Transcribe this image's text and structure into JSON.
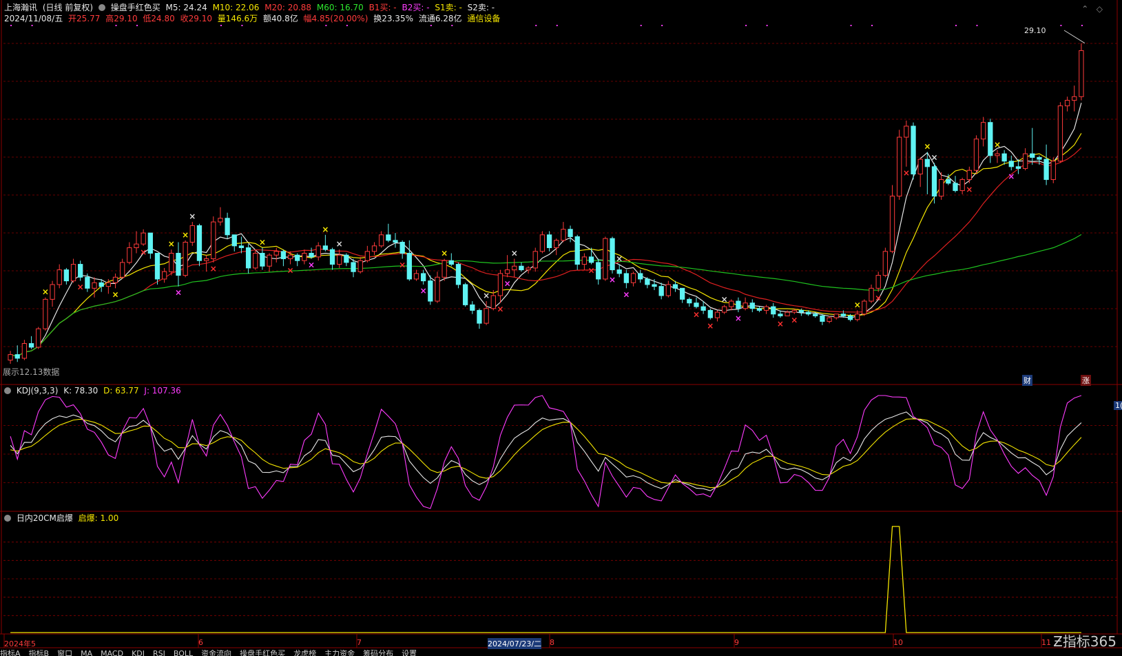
{
  "header": {
    "stock_name": "上海瀚讯",
    "period": "(日线 前复权)",
    "indicator": "操盘手红色买",
    "m5": "M5: 24.24",
    "m10": "M10: 22.06",
    "m20": "M20: 20.88",
    "m60": "M60: 16.70",
    "b1": "B1买: -",
    "b2": "B2买: -",
    "s1": "S1卖: -",
    "s2": "S2卖: -"
  },
  "info": {
    "date": "2024/11/08/五",
    "open": "开25.77",
    "high": "高29.10",
    "low": "低24.80",
    "close": "收29.10",
    "volume": "量146.6万",
    "amount": "额40.8亿",
    "change": "幅4.85(20.00%)",
    "turnover": "换23.35%",
    "float": "流通6.28亿",
    "sector": "通信设备"
  },
  "price_label": "29.10",
  "overlay_text": "展示12.13数据",
  "tags": {
    "cai": "财",
    "zhang": "涨"
  },
  "kdj": {
    "title": "KDJ(9,3,3)",
    "k": "K: 78.30",
    "d": "D: 63.77",
    "j": "J: 107.36"
  },
  "burst": {
    "title": "日内20CM启爆",
    "value": "启爆: 1.00"
  },
  "x_axis": [
    "2024年5",
    "6",
    "7",
    "2024/07/23/二",
    "8",
    "9",
    "10",
    "11"
  ],
  "right_tag": "1(",
  "watermark": "指标365",
  "bottom_tabs": [
    "指标A",
    "指标B",
    "窗口",
    "MA",
    "MACD",
    "KDJ",
    "RSI",
    "BOLL",
    "资金流向",
    "操盘手红色买",
    "龙虎榜",
    "主力资金",
    "筹码分布",
    "设置"
  ],
  "colors": {
    "up": "#ff3b3b",
    "down": "#5ff3f3",
    "ma5": "#e8e8e8",
    "ma10": "#f5e600",
    "ma20": "#e02020",
    "ma60": "#1fc41f",
    "grid": "#8b0000",
    "j": "#ff3cff"
  },
  "chart_data": {
    "type": "candlestick",
    "candles": [
      [
        12.1,
        12.6,
        11.9,
        12.4
      ],
      [
        12.4,
        12.9,
        12.0,
        12.2
      ],
      [
        12.2,
        13.2,
        12.1,
        13.0
      ],
      [
        13.0,
        13.4,
        12.7,
        12.8
      ],
      [
        12.8,
        13.9,
        12.7,
        13.8
      ],
      [
        13.8,
        15.5,
        13.7,
        15.4
      ],
      [
        15.4,
        16.4,
        15.0,
        16.2
      ],
      [
        16.2,
        17.3,
        16.0,
        17.0
      ],
      [
        17.0,
        17.1,
        16.2,
        16.4
      ],
      [
        16.4,
        17.6,
        16.3,
        17.3
      ],
      [
        17.3,
        17.5,
        16.4,
        16.6
      ],
      [
        16.6,
        16.8,
        15.8,
        16.0
      ],
      [
        16.0,
        16.6,
        15.5,
        16.3
      ],
      [
        16.3,
        16.5,
        15.8,
        16.1
      ],
      [
        16.1,
        16.5,
        15.7,
        16.3
      ],
      [
        16.3,
        16.8,
        16.0,
        16.6
      ],
      [
        16.6,
        17.6,
        16.5,
        17.4
      ],
      [
        17.4,
        18.5,
        17.3,
        18.2
      ],
      [
        18.2,
        19.1,
        17.9,
        18.4
      ],
      [
        18.4,
        19.2,
        18.3,
        19.0
      ],
      [
        19.0,
        19.0,
        17.6,
        17.9
      ],
      [
        17.9,
        17.9,
        16.2,
        16.5
      ],
      [
        16.5,
        17.1,
        16.3,
        16.9
      ],
      [
        16.9,
        18.1,
        16.7,
        17.9
      ],
      [
        17.9,
        18.5,
        16.1,
        16.7
      ],
      [
        16.7,
        18.6,
        16.6,
        18.5
      ],
      [
        18.5,
        19.6,
        18.3,
        19.4
      ],
      [
        19.4,
        19.5,
        17.2,
        17.5
      ],
      [
        17.5,
        17.8,
        16.9,
        17.6
      ],
      [
        17.6,
        19.9,
        17.4,
        19.6
      ],
      [
        19.6,
        20.4,
        19.4,
        19.8
      ],
      [
        19.8,
        20.1,
        18.7,
        18.9
      ],
      [
        18.9,
        18.9,
        18.0,
        18.3
      ],
      [
        18.3,
        18.8,
        17.9,
        18.2
      ],
      [
        18.2,
        18.4,
        16.8,
        17.1
      ],
      [
        17.1,
        18.1,
        17.0,
        17.9
      ],
      [
        17.9,
        18.2,
        17.0,
        17.2
      ],
      [
        17.2,
        17.9,
        16.9,
        17.8
      ],
      [
        17.8,
        18.2,
        17.4,
        18.0
      ],
      [
        18.0,
        18.1,
        17.2,
        17.6
      ],
      [
        17.6,
        18.0,
        17.3,
        17.8
      ],
      [
        17.8,
        17.9,
        17.2,
        17.5
      ],
      [
        17.5,
        18.1,
        17.3,
        17.9
      ],
      [
        17.9,
        18.2,
        17.6,
        17.7
      ],
      [
        17.7,
        18.5,
        17.5,
        18.3
      ],
      [
        18.3,
        18.9,
        18.0,
        18.1
      ],
      [
        18.1,
        18.2,
        17.0,
        17.3
      ],
      [
        17.3,
        18.1,
        17.1,
        17.8
      ],
      [
        17.8,
        17.9,
        17.2,
        17.4
      ],
      [
        17.4,
        17.6,
        16.6,
        16.9
      ],
      [
        16.9,
        17.7,
        16.8,
        17.5
      ],
      [
        17.5,
        18.3,
        17.4,
        18.0
      ],
      [
        18.0,
        18.5,
        17.8,
        18.3
      ],
      [
        18.3,
        19.1,
        18.2,
        18.9
      ],
      [
        18.9,
        19.5,
        18.5,
        18.6
      ],
      [
        18.6,
        19.0,
        18.2,
        18.5
      ],
      [
        18.5,
        18.6,
        17.6,
        17.9
      ],
      [
        17.9,
        18.6,
        16.4,
        16.5
      ],
      [
        16.5,
        17.0,
        16.4,
        16.8
      ],
      [
        16.8,
        17.0,
        16.2,
        16.4
      ],
      [
        16.4,
        16.7,
        15.1,
        15.3
      ],
      [
        15.3,
        16.9,
        15.2,
        16.6
      ],
      [
        16.6,
        17.6,
        16.4,
        17.5
      ],
      [
        17.5,
        17.9,
        17.2,
        17.3
      ],
      [
        17.3,
        17.4,
        16.0,
        16.2
      ],
      [
        16.2,
        16.3,
        15.0,
        15.1
      ],
      [
        15.1,
        15.3,
        14.6,
        14.8
      ],
      [
        14.8,
        14.9,
        13.8,
        14.1
      ],
      [
        14.1,
        15.3,
        14.0,
        14.9
      ],
      [
        14.9,
        15.9,
        14.8,
        15.6
      ],
      [
        15.6,
        17.0,
        15.2,
        16.8
      ],
      [
        16.8,
        17.8,
        16.6,
        17.0
      ],
      [
        17.0,
        17.6,
        16.6,
        17.2
      ],
      [
        17.2,
        17.4,
        16.9,
        17.0
      ],
      [
        17.0,
        17.2,
        16.8,
        17.1
      ],
      [
        17.1,
        18.2,
        16.9,
        18.0
      ],
      [
        18.0,
        19.1,
        17.9,
        18.9
      ],
      [
        18.9,
        19.1,
        18.0,
        18.2
      ],
      [
        18.2,
        18.7,
        17.8,
        18.6
      ],
      [
        18.6,
        19.6,
        18.5,
        19.2
      ],
      [
        19.2,
        19.4,
        18.5,
        18.8
      ],
      [
        18.8,
        18.9,
        17.0,
        17.3
      ],
      [
        17.3,
        17.9,
        17.0,
        17.7
      ],
      [
        17.7,
        18.2,
        17.3,
        17.4
      ],
      [
        17.4,
        17.6,
        16.2,
        16.5
      ],
      [
        16.5,
        18.8,
        16.4,
        18.7
      ],
      [
        18.7,
        18.8,
        16.8,
        17.0
      ],
      [
        17.0,
        17.3,
        16.6,
        16.8
      ],
      [
        16.8,
        17.0,
        16.0,
        16.3
      ],
      [
        16.3,
        16.9,
        16.1,
        16.8
      ],
      [
        16.8,
        17.0,
        16.3,
        16.5
      ],
      [
        16.5,
        16.6,
        16.0,
        16.2
      ],
      [
        16.2,
        16.5,
        15.9,
        16.1
      ],
      [
        16.1,
        16.3,
        15.4,
        15.6
      ],
      [
        15.6,
        16.4,
        15.5,
        16.2
      ],
      [
        16.2,
        16.4,
        15.8,
        16.0
      ],
      [
        16.0,
        16.0,
        15.2,
        15.4
      ],
      [
        15.4,
        15.5,
        15.0,
        15.2
      ],
      [
        15.2,
        15.5,
        14.9,
        15.0
      ],
      [
        15.0,
        15.3,
        14.6,
        14.8
      ],
      [
        14.8,
        14.9,
        14.3,
        14.4
      ],
      [
        14.4,
        14.8,
        14.2,
        14.7
      ],
      [
        14.7,
        15.1,
        14.6,
        15.0
      ],
      [
        15.0,
        15.4,
        14.8,
        15.3
      ],
      [
        15.3,
        15.5,
        14.7,
        14.9
      ],
      [
        14.9,
        15.5,
        14.8,
        15.2
      ],
      [
        15.2,
        15.4,
        14.7,
        14.9
      ],
      [
        14.9,
        15.0,
        14.7,
        14.8
      ],
      [
        14.8,
        15.1,
        14.6,
        15.0
      ],
      [
        15.0,
        15.2,
        14.4,
        14.6
      ],
      [
        14.6,
        14.8,
        14.4,
        14.5
      ],
      [
        14.5,
        14.8,
        14.5,
        14.7
      ],
      [
        14.7,
        14.9,
        14.6,
        14.8
      ],
      [
        14.8,
        14.9,
        14.5,
        14.7
      ],
      [
        14.7,
        14.8,
        14.5,
        14.6
      ],
      [
        14.6,
        14.7,
        14.4,
        14.5
      ],
      [
        14.5,
        14.6,
        14.0,
        14.2
      ],
      [
        14.2,
        14.5,
        14.1,
        14.4
      ],
      [
        14.4,
        14.6,
        14.3,
        14.6
      ],
      [
        14.6,
        14.8,
        14.4,
        14.5
      ],
      [
        14.5,
        14.6,
        14.2,
        14.3
      ],
      [
        14.3,
        14.8,
        14.2,
        14.6
      ],
      [
        14.6,
        15.4,
        14.5,
        15.3
      ],
      [
        15.3,
        16.2,
        15.2,
        16.0
      ],
      [
        16.0,
        16.9,
        15.8,
        16.7
      ],
      [
        16.7,
        18.2,
        16.6,
        18.0
      ],
      [
        18.0,
        21.6,
        17.9,
        21.0
      ],
      [
        21.0,
        24.6,
        20.8,
        24.2
      ],
      [
        24.2,
        25.1,
        22.6,
        24.8
      ],
      [
        24.8,
        25.0,
        21.9,
        22.2
      ],
      [
        22.2,
        23.1,
        21.5,
        23.0
      ],
      [
        23.0,
        23.4,
        21.1,
        22.6
      ],
      [
        22.6,
        22.8,
        20.6,
        21.0
      ],
      [
        21.0,
        22.3,
        20.8,
        21.9
      ],
      [
        21.9,
        22.2,
        21.6,
        21.7
      ],
      [
        21.7,
        22.1,
        21.2,
        21.3
      ],
      [
        21.3,
        22.0,
        21.1,
        21.9
      ],
      [
        21.9,
        22.6,
        21.7,
        22.4
      ],
      [
        22.4,
        24.3,
        22.2,
        24.1
      ],
      [
        24.1,
        25.3,
        23.7,
        25.0
      ],
      [
        25.0,
        25.2,
        22.8,
        23.2
      ],
      [
        23.2,
        23.5,
        22.8,
        23.3
      ],
      [
        23.3,
        23.5,
        22.7,
        22.9
      ],
      [
        22.9,
        23.2,
        22.4,
        22.6
      ],
      [
        22.6,
        23.0,
        22.2,
        22.5
      ],
      [
        22.5,
        23.6,
        22.4,
        23.3
      ],
      [
        23.3,
        24.7,
        22.7,
        23.1
      ],
      [
        23.1,
        23.2,
        22.7,
        23.0
      ],
      [
        23.0,
        23.8,
        21.6,
        21.9
      ],
      [
        21.9,
        23.1,
        21.7,
        22.9
      ],
      [
        22.9,
        26.1,
        22.8,
        25.9
      ],
      [
        25.9,
        26.4,
        25.6,
        26.2
      ],
      [
        26.2,
        27.0,
        25.6,
        26.4
      ],
      [
        26.4,
        29.3,
        26.2,
        28.9
      ]
    ],
    "ma_series": [
      "MA5",
      "MA10",
      "MA20",
      "MA60"
    ],
    "kdj_series": [
      "K",
      "D",
      "J"
    ],
    "price_range": [
      11,
      30
    ]
  }
}
